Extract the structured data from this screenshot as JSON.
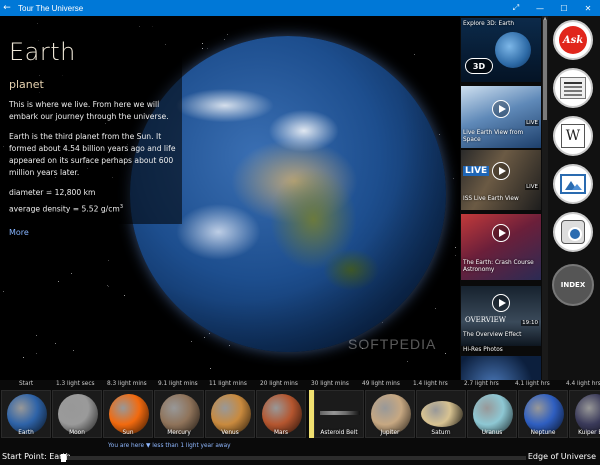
{
  "window": {
    "title": "Tour The Universe",
    "back_icon": "back-arrow-icon",
    "controls": [
      "expand-icon",
      "minimize-icon",
      "maximize-icon",
      "close-icon"
    ]
  },
  "info": {
    "title": "Earth",
    "subtitle": "planet",
    "intro": "This is where we live. From here we will embark our journey through the universe.",
    "body": "Earth is the third planet from the Sun. It formed about 4.54 billion years ago and life appeared on its surface perhaps about 600 million years later.",
    "diameter": "diameter = 12,800 km",
    "density": "average density = 5.52 g/cm",
    "density_exp": "3",
    "more": "More"
  },
  "media": [
    {
      "caption": "Explore 3D: Earth",
      "badge": "3D",
      "type": "3d"
    },
    {
      "caption": "Live Earth View from Space",
      "badge": "LIVE",
      "type": "video"
    },
    {
      "caption": "ISS Live Earth View",
      "badge": "LIVE",
      "type": "video"
    },
    {
      "caption": "The Earth: Crash Course Astronomy",
      "badge": "",
      "type": "video"
    },
    {
      "caption": "The Overview Effect",
      "badge": "19:10",
      "type": "video"
    },
    {
      "caption": "Hi-Res Photos",
      "badge": "",
      "type": "photos"
    }
  ],
  "side_buttons": [
    {
      "name": "ask-button",
      "label": "Ask",
      "icon": "ask-icon"
    },
    {
      "name": "news-button",
      "label": "NEWS",
      "icon": "news-icon"
    },
    {
      "name": "wikipedia-button",
      "label": "W",
      "icon": "wikipedia-icon"
    },
    {
      "name": "photos-button",
      "label": "",
      "icon": "photos-icon"
    },
    {
      "name": "video-button",
      "label": "VIDEO",
      "icon": "video-icon"
    },
    {
      "name": "index-button",
      "label": "INDEX",
      "icon": ""
    }
  ],
  "strip": {
    "distances": [
      "Start",
      "1.3 light secs",
      "8.3 light mins",
      "9.1 light mins",
      "11 light mins",
      "20 light mins",
      "30 light mins",
      "49 light mins",
      "1.4 light hrs",
      "2.7 light hrs",
      "4.1 light hrs",
      "4.4 light hrs"
    ],
    "objects": [
      {
        "name": "Earth",
        "color": "#2e63a8"
      },
      {
        "name": "Moon",
        "color": "#9a9a9a"
      },
      {
        "name": "Sun",
        "color": "#f26a0f"
      },
      {
        "name": "Mercury",
        "color": "#8f735a"
      },
      {
        "name": "Venus",
        "color": "#c98a3e"
      },
      {
        "name": "Mars",
        "color": "#b5562f"
      },
      {
        "name": "Asteroid Belt",
        "color": "#6d6d6d"
      },
      {
        "name": "Jupiter",
        "color": "#c7a882"
      },
      {
        "name": "Saturn",
        "color": "#d8c392"
      },
      {
        "name": "Uranus",
        "color": "#8ec8d4"
      },
      {
        "name": "Neptune",
        "color": "#2f5fc1"
      },
      {
        "name": "Kuiper Belt",
        "color": "#3a3a5a"
      }
    ],
    "you_are_here": "You are here ▼ less than 1 light year away",
    "start_point": "Start Point: Earth",
    "end_point": "Edge of Universe",
    "progress": 0.01
  },
  "watermark": "SOFTPEDIA"
}
